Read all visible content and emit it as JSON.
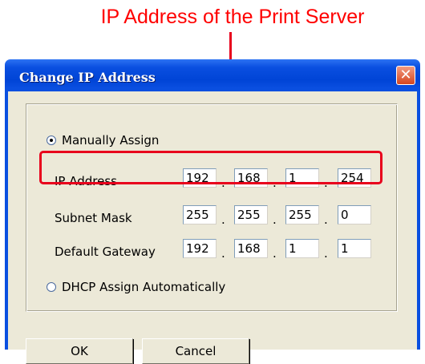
{
  "callout": {
    "text": "IP Address of the Print Server"
  },
  "window": {
    "title": "Change IP Address",
    "close_glyph": "✕"
  },
  "options": {
    "manual": "Manually Assign",
    "dhcp": "DHCP Assign Automatically",
    "selected": "manual"
  },
  "fields": {
    "ip_label": "IP Address",
    "ip": [
      "192",
      "168",
      "1",
      "254"
    ],
    "mask_label": "Subnet Mask",
    "mask": [
      "255",
      "255",
      "255",
      "0"
    ],
    "gateway_label": "Default Gateway",
    "gateway": [
      "192",
      "168",
      "1",
      "1"
    ],
    "separator": "."
  },
  "buttons": {
    "ok": "OK",
    "cancel": "Cancel"
  },
  "colors": {
    "title_bar": "#0a4fe0",
    "dialog_bg": "#ece9d8",
    "annotation": "#e8001c",
    "close_button": "#d5461f"
  },
  "icons": {
    "close": "close-icon",
    "radio_checked": "radio-checked-icon",
    "radio_unchecked": "radio-unchecked-icon"
  }
}
